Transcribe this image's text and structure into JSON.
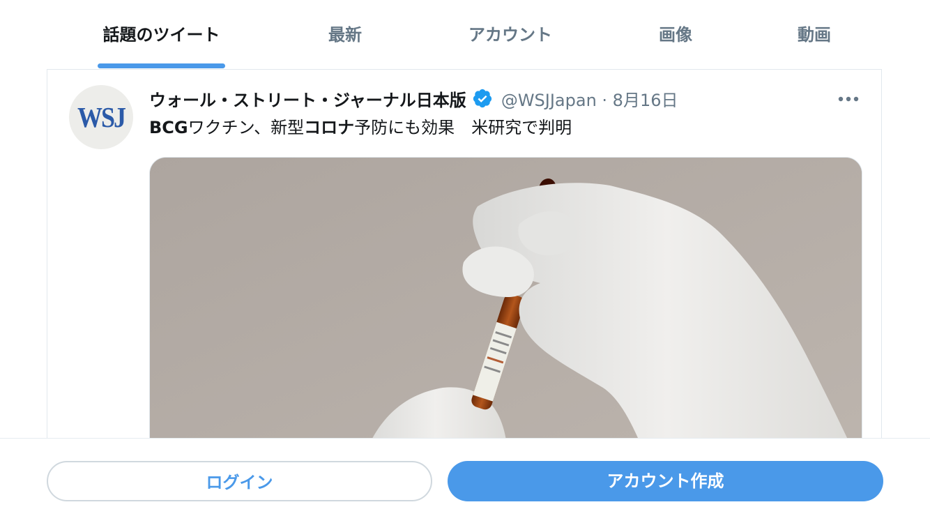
{
  "tabs": [
    {
      "label": "話題のツイート",
      "active": true
    },
    {
      "label": "最新",
      "active": false
    },
    {
      "label": "アカウント",
      "active": false
    },
    {
      "label": "画像",
      "active": false
    },
    {
      "label": "動画",
      "active": false
    }
  ],
  "tweet": {
    "avatar_text": "WSJ",
    "author_name": "ウォール・ストリート・ジャーナル日本版",
    "verified": true,
    "handle_date": "@WSJJapan · 8月16日",
    "text_parts": {
      "p1": "BCG",
      "p2": "ワクチン、新型",
      "p3": "コロナ",
      "p4": "予防にも効果　米研究で判明"
    },
    "media_alt": "vaccine-ampoule-gloved-hand"
  },
  "bottom": {
    "login_label": "ログイン",
    "signup_label": "アカウント作成"
  },
  "colors": {
    "accent": "#4a99e9",
    "text_secondary": "#657786",
    "text_primary": "#14171a"
  },
  "icons": [
    "verified-badge-icon",
    "more-options-icon"
  ]
}
